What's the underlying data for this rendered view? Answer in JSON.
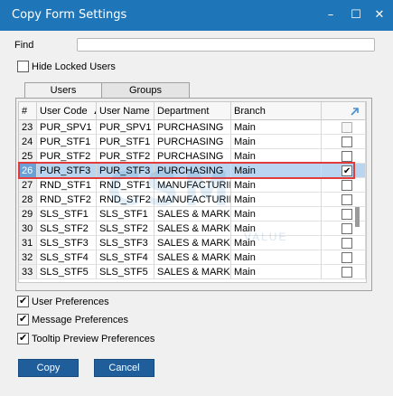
{
  "window": {
    "title": "Copy Form Settings",
    "minimize_glyph": "–",
    "maximize_glyph": "☐",
    "close_glyph": "✕"
  },
  "find": {
    "label": "Find",
    "value": ""
  },
  "hide_locked": {
    "label": "Hide Locked Users",
    "checked": false
  },
  "tabs": [
    {
      "label": "Users",
      "active": true
    },
    {
      "label": "Groups",
      "active": false
    }
  ],
  "grid": {
    "columns": [
      "#",
      "User Code",
      "User Name",
      "Department",
      "Branch",
      ""
    ],
    "sort_indicator": "▲",
    "expand_icon": "expand-arrow-icon",
    "rows": [
      {
        "num": "23",
        "code": "PUR_SPV1",
        "name": "PUR_SPV1",
        "dept": "PURCHASING",
        "branch": "Main",
        "checked": false,
        "disabled": true
      },
      {
        "num": "24",
        "code": "PUR_STF1",
        "name": "PUR_STF1",
        "dept": "PURCHASING",
        "branch": "Main",
        "checked": false,
        "disabled": false
      },
      {
        "num": "25",
        "code": "PUR_STF2",
        "name": "PUR_STF2",
        "dept": "PURCHASING",
        "branch": "Main",
        "checked": false,
        "disabled": false
      },
      {
        "num": "26",
        "code": "PUR_STF3",
        "name": "PUR_STF3",
        "dept": "PURCHASING",
        "branch": "Main",
        "checked": true,
        "disabled": false,
        "selected": true
      },
      {
        "num": "27",
        "code": "RND_STF1",
        "name": "RND_STF1",
        "dept": "MANUFACTURING",
        "branch": "Main",
        "checked": false,
        "disabled": false
      },
      {
        "num": "28",
        "code": "RND_STF2",
        "name": "RND_STF2",
        "dept": "MANUFACTURING",
        "branch": "Main",
        "checked": false,
        "disabled": false
      },
      {
        "num": "29",
        "code": "SLS_STF1",
        "name": "SLS_STF1",
        "dept": "SALES & MARKETING",
        "branch": "Main",
        "checked": false,
        "disabled": false
      },
      {
        "num": "30",
        "code": "SLS_STF2",
        "name": "SLS_STF2",
        "dept": "SALES & MARKETING",
        "branch": "Main",
        "checked": false,
        "disabled": false
      },
      {
        "num": "31",
        "code": "SLS_STF3",
        "name": "SLS_STF3",
        "dept": "SALES & MARKETING",
        "branch": "Main",
        "checked": false,
        "disabled": false
      },
      {
        "num": "32",
        "code": "SLS_STF4",
        "name": "SLS_STF4",
        "dept": "SALES & MARKETING",
        "branch": "Main",
        "checked": false,
        "disabled": false
      },
      {
        "num": "33",
        "code": "SLS_STF5",
        "name": "SLS_STF5",
        "dept": "SALES & MARKETING",
        "branch": "Main",
        "checked": false,
        "disabled": false
      }
    ]
  },
  "options": [
    {
      "label": "User Preferences",
      "checked": true
    },
    {
      "label": "Message Preferences",
      "checked": true
    },
    {
      "label": "Tooltip Preview Preferences",
      "checked": true
    }
  ],
  "buttons": {
    "copy": "Copy",
    "cancel": "Cancel"
  },
  "colors": {
    "titlebar": "#1e76b9",
    "button": "#1f5d9b",
    "highlight": "#e23b3b",
    "selection": "#b9d5f0"
  }
}
